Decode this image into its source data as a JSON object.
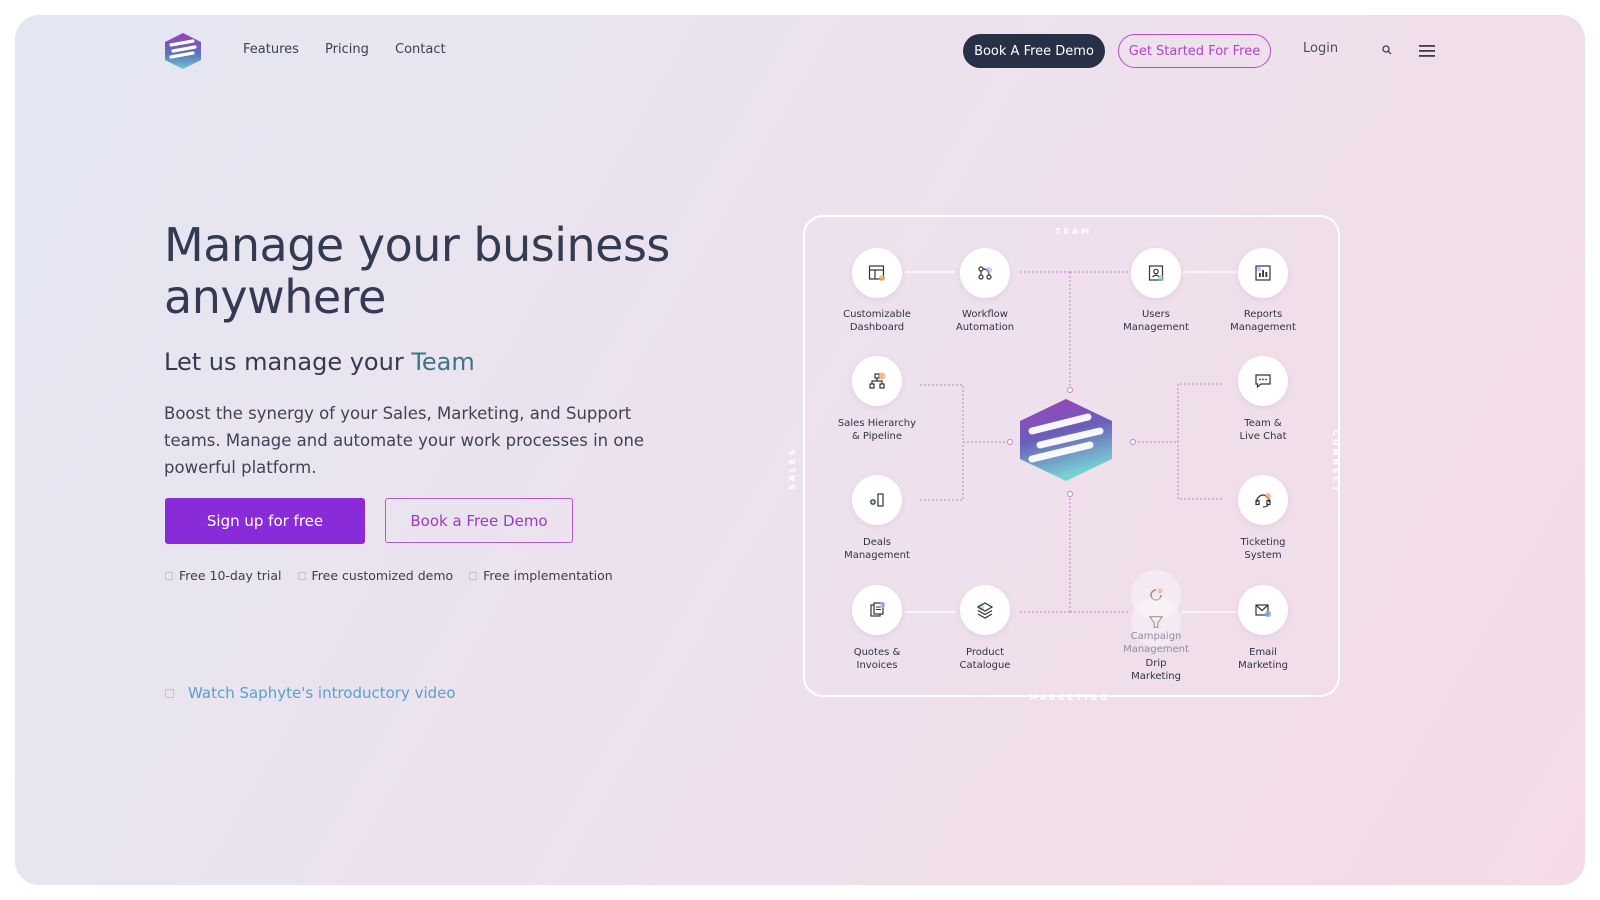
{
  "nav": {
    "links": [
      "Features",
      "Pricing",
      "Contact"
    ],
    "book_demo": "Book A Free Demo",
    "get_started": "Get Started For Free",
    "login": "Login"
  },
  "hero": {
    "headline_line1": "Manage your business",
    "headline_line2": "anywhere",
    "subhead_prefix": "Let us manage your ",
    "subhead_accent": "Team",
    "body": "Boost the synergy of your Sales, Marketing, and Support teams. Manage and automate your work processes in one powerful platform.",
    "signup_label": "Sign up for free",
    "demo_label": "Book a Free Demo",
    "perks": [
      "Free 10-day trial",
      "Free customized demo",
      "Free implementation"
    ],
    "video_link": "Watch Saphyte's introductory video"
  },
  "diagram": {
    "sections": {
      "top": "TEAM",
      "left": "SALES",
      "right": "CONNECT",
      "bottom": "MARKETING"
    },
    "nodes": [
      {
        "id": "customizable-dashboard",
        "line1": "Customizable",
        "line2": "Dashboard",
        "icon": "dashboard-icon"
      },
      {
        "id": "workflow-automation",
        "line1": "Workflow",
        "line2": "Automation",
        "icon": "workflow-icon"
      },
      {
        "id": "users-management",
        "line1": "Users",
        "line2": "Management",
        "icon": "users-icon"
      },
      {
        "id": "reports-management",
        "line1": "Reports",
        "line2": "Management",
        "icon": "reports-icon"
      },
      {
        "id": "sales-hierarchy",
        "line1": "Sales Hierarchy",
        "line2": "& Pipeline",
        "icon": "hierarchy-icon"
      },
      {
        "id": "team-live-chat",
        "line1": "Team &",
        "line2": "Live Chat",
        "icon": "chat-icon"
      },
      {
        "id": "deals-management",
        "line1": "Deals",
        "line2": "Management",
        "icon": "deals-icon"
      },
      {
        "id": "ticketing-system",
        "line1": "Ticketing",
        "line2": "System",
        "icon": "headset-icon"
      },
      {
        "id": "quotes-invoices",
        "line1": "Quotes &",
        "line2": "Invoices",
        "icon": "invoice-icon"
      },
      {
        "id": "product-catalogue",
        "line1": "Product",
        "line2": "Catalogue",
        "icon": "layers-icon"
      },
      {
        "id": "campaign-drip",
        "line1": "Campaign",
        "line2": "Management",
        "line3": "Drip",
        "line4": "Marketing",
        "icon": "funnel-icon"
      },
      {
        "id": "email-marketing",
        "line1": "Email",
        "line2": "Marketing",
        "icon": "email-icon"
      }
    ]
  },
  "colors": {
    "primary_purple": "#8a2bd9",
    "dark_navy": "#273047",
    "accent_teal": "#3f7486",
    "link_blue": "#5aa0c7",
    "connector": "#c97fd1"
  }
}
